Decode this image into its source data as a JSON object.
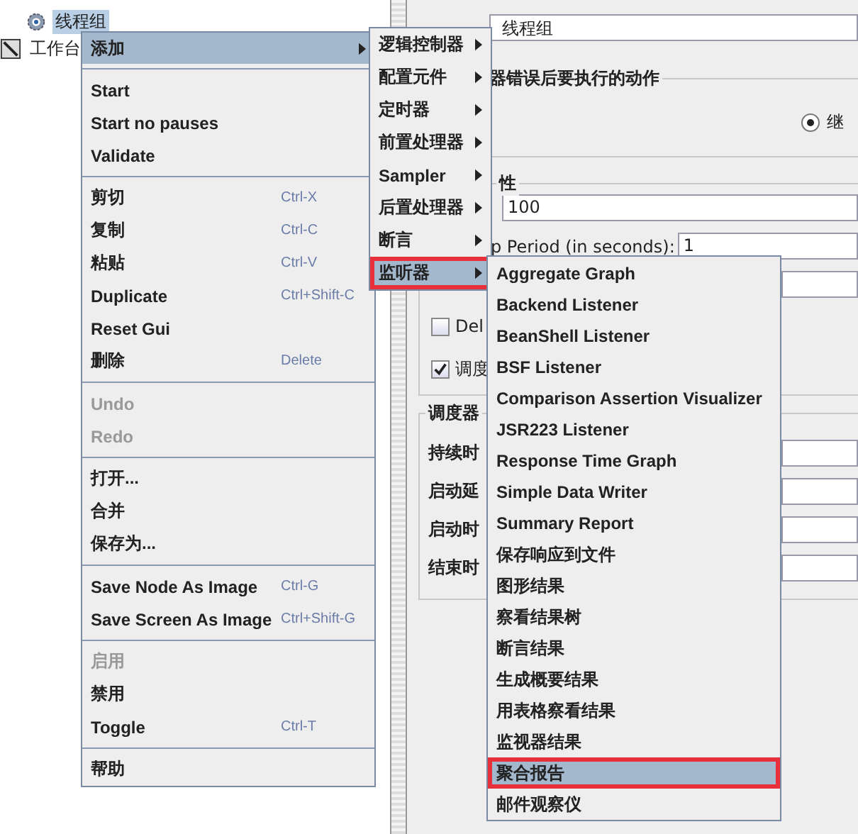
{
  "tree": [
    {
      "label": "线程组",
      "selected": true,
      "kind": "gear"
    },
    {
      "label": "工作台",
      "selected": false,
      "kind": "bench"
    }
  ],
  "form": {
    "name_value": "线程组",
    "error_group_title": "器错误后要执行的动作",
    "radio": {
      "label": "继",
      "selected": true
    },
    "props_group_title": "性",
    "threads_value": "100",
    "ramp_label": "p Period (in seconds):",
    "ramp_value": "1",
    "checkboxes": [
      {
        "label": "Del",
        "checked": false
      },
      {
        "label": "调度",
        "checked": true
      }
    ],
    "scheduler_title": "调度器",
    "scheduler_labels": [
      "持续时",
      "启动延",
      "启动时",
      "结束时"
    ]
  },
  "main_menu": {
    "groups": [
      [
        {
          "label": "添加",
          "selected": true,
          "submenu": true,
          "disabled": false
        }
      ],
      [
        {
          "label": "Start",
          "selected": false,
          "disabled": false
        },
        {
          "label": "Start no pauses",
          "selected": false,
          "disabled": false
        },
        {
          "label": "Validate",
          "selected": false,
          "disabled": false
        }
      ],
      [
        {
          "label": "剪切",
          "shortcut": "Ctrl-X",
          "selected": false,
          "disabled": false
        },
        {
          "label": "复制",
          "shortcut": "Ctrl-C",
          "selected": false,
          "disabled": false
        },
        {
          "label": "粘贴",
          "shortcut": "Ctrl-V",
          "selected": false,
          "disabled": false
        },
        {
          "label": "Duplicate",
          "shortcut": "Ctrl+Shift-C",
          "selected": false,
          "disabled": false
        },
        {
          "label": "Reset Gui",
          "selected": false,
          "disabled": false
        },
        {
          "label": "删除",
          "shortcut": "Delete",
          "selected": false,
          "disabled": false
        }
      ],
      [
        {
          "label": "Undo",
          "selected": false,
          "disabled": true
        },
        {
          "label": "Redo",
          "selected": false,
          "disabled": true
        }
      ],
      [
        {
          "label": "打开...",
          "selected": false,
          "disabled": false
        },
        {
          "label": "合并",
          "selected": false,
          "disabled": false
        },
        {
          "label": "保存为...",
          "selected": false,
          "disabled": false
        }
      ],
      [
        {
          "label": "Save Node As Image",
          "shortcut": "Ctrl-G",
          "selected": false,
          "disabled": false
        },
        {
          "label": "Save Screen As Image",
          "shortcut": "Ctrl+Shift-G",
          "selected": false,
          "disabled": false
        }
      ],
      [
        {
          "label": "启用",
          "selected": false,
          "disabled": true
        },
        {
          "label": "禁用",
          "selected": false,
          "disabled": false
        },
        {
          "label": "Toggle",
          "shortcut": "Ctrl-T",
          "selected": false,
          "disabled": false
        }
      ],
      [
        {
          "label": "帮助",
          "selected": false,
          "disabled": false
        }
      ]
    ]
  },
  "add_menu": [
    {
      "label": "逻辑控制器",
      "selected": false,
      "highlighted": false
    },
    {
      "label": "配置元件",
      "selected": false,
      "highlighted": false
    },
    {
      "label": "定时器",
      "selected": false,
      "highlighted": false
    },
    {
      "label": "前置处理器",
      "selected": false,
      "highlighted": false
    },
    {
      "label": "Sampler",
      "selected": false,
      "highlighted": false
    },
    {
      "label": "后置处理器",
      "selected": false,
      "highlighted": false
    },
    {
      "label": "断言",
      "selected": false,
      "highlighted": false
    },
    {
      "label": "监听器",
      "selected": true,
      "highlighted": true
    }
  ],
  "listener_menu": [
    {
      "label": "Aggregate Graph",
      "selected": false,
      "highlighted": false
    },
    {
      "label": "Backend Listener",
      "selected": false,
      "highlighted": false
    },
    {
      "label": "BeanShell Listener",
      "selected": false,
      "highlighted": false
    },
    {
      "label": "BSF Listener",
      "selected": false,
      "highlighted": false
    },
    {
      "label": "Comparison Assertion Visualizer",
      "selected": false,
      "highlighted": false
    },
    {
      "label": "JSR223 Listener",
      "selected": false,
      "highlighted": false
    },
    {
      "label": "Response Time Graph",
      "selected": false,
      "highlighted": false
    },
    {
      "label": "Simple Data Writer",
      "selected": false,
      "highlighted": false
    },
    {
      "label": "Summary Report",
      "selected": false,
      "highlighted": false
    },
    {
      "label": "保存响应到文件",
      "selected": false,
      "highlighted": false
    },
    {
      "label": "图形结果",
      "selected": false,
      "highlighted": false
    },
    {
      "label": "察看结果树",
      "selected": false,
      "highlighted": false
    },
    {
      "label": "断言结果",
      "selected": false,
      "highlighted": false
    },
    {
      "label": "生成概要结果",
      "selected": false,
      "highlighted": false
    },
    {
      "label": "用表格察看结果",
      "selected": false,
      "highlighted": false
    },
    {
      "label": "监视器结果",
      "selected": false,
      "highlighted": false
    },
    {
      "label": "聚合报告",
      "selected": true,
      "highlighted": true
    },
    {
      "label": "邮件观察仪",
      "selected": false,
      "highlighted": false
    }
  ]
}
